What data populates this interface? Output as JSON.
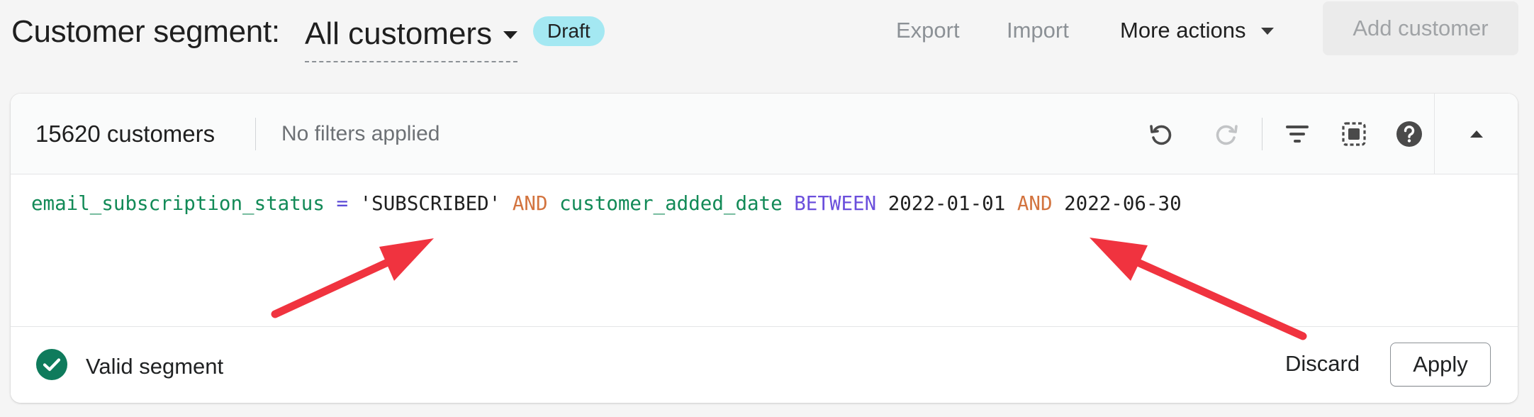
{
  "header": {
    "title": "Customer segment:",
    "segment_name": "All customers",
    "status_badge": "Draft",
    "export_label": "Export",
    "import_label": "Import",
    "more_actions_label": "More actions",
    "add_customer_label": "Add customer"
  },
  "toolbar": {
    "customer_count": "15620 customers",
    "filters_status": "No filters applied",
    "icons": [
      "undo-icon",
      "redo-icon",
      "filter-icon",
      "select-area-icon",
      "help-icon",
      "chevron-up-icon"
    ]
  },
  "editor": {
    "tokens": {
      "field1": "email_subscription_status",
      "op1": "=",
      "value1": "'SUBSCRIBED'",
      "and1": "AND",
      "field2": "customer_added_date",
      "between": "BETWEEN",
      "date_start": "2022-01-01",
      "and2": "AND",
      "date_end": "2022-06-30"
    }
  },
  "footer": {
    "status_text": "Valid segment",
    "discard_label": "Discard",
    "apply_label": "Apply"
  },
  "colors": {
    "badge": "#a4e8f2",
    "valid_green": "#0f7b5c",
    "annotation_arrow": "#f0333f",
    "field_token": "#128a57",
    "keyword_token": "#d3743f",
    "operator_token": "#5c4bd6"
  }
}
